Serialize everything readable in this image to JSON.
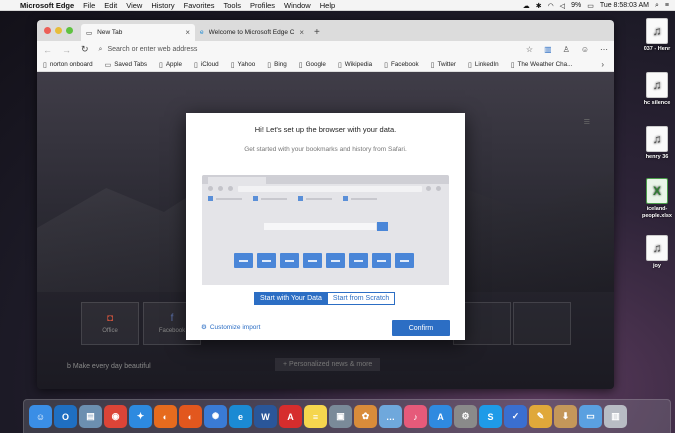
{
  "menubar": {
    "app_name": "Microsoft Edge",
    "items": [
      "File",
      "Edit",
      "View",
      "History",
      "Favorites",
      "Tools",
      "Profiles",
      "Window",
      "Help"
    ],
    "battery": "9%",
    "datetime": "Tue 8:58:03 AM"
  },
  "desktop": {
    "items": [
      {
        "label": "037 - Henr",
        "icon": "audio-file-icon"
      },
      {
        "label": "hc silence",
        "icon": "audio-file-icon"
      },
      {
        "label": "henry 36",
        "icon": "audio-file-icon"
      },
      {
        "label": "iceland-people.xlsx",
        "icon": "excel-file-icon"
      },
      {
        "label": "joy",
        "icon": "audio-file-icon"
      }
    ]
  },
  "browser": {
    "tabs": [
      {
        "title": "New Tab",
        "active": true
      },
      {
        "title": "Welcome to Microsoft Edge Ca",
        "active": false
      }
    ],
    "address_placeholder": "Search or enter web address",
    "favorites": [
      "norton onboard",
      "Saved Tabs",
      "Apple",
      "iCloud",
      "Yahoo",
      "Bing",
      "Google",
      "Wikipedia",
      "Facebook",
      "Twitter",
      "LinkedIn",
      "The Weather Cha..."
    ]
  },
  "newtab": {
    "tiles": [
      "Office",
      "Facebook"
    ],
    "footer_text": "Make every day beautiful",
    "news_button": "Personalized news & more"
  },
  "dialog": {
    "title": "Hi! Let's set up the browser with your data.",
    "subtitle": "Get started with your bookmarks and history from Safari.",
    "option_data": "Start with Your Data",
    "option_scratch": "Start from Scratch",
    "customize_label": "Customize import",
    "confirm_label": "Confirm"
  },
  "colors": {
    "accent": "#2c6ec4",
    "illustration_blue": "#4a86d8"
  },
  "dock": [
    {
      "name": "finder-icon",
      "color": "#3a8ee6",
      "glyph": "☺"
    },
    {
      "name": "outlook-icon",
      "color": "#1f6fc2",
      "glyph": "O"
    },
    {
      "name": "preview-icon",
      "color": "#6c8fb0",
      "glyph": "▤"
    },
    {
      "name": "chrome-icon",
      "color": "#db4437",
      "glyph": "◉"
    },
    {
      "name": "safari-icon",
      "color": "#2d8ae0",
      "glyph": "✦"
    },
    {
      "name": "firefox-icon",
      "color": "#e66b1e",
      "glyph": "◐"
    },
    {
      "name": "firefox-dev-icon",
      "color": "#e2571e",
      "glyph": "◐"
    },
    {
      "name": "settings-gear-icon",
      "color": "#3a7bd5",
      "glyph": "✺"
    },
    {
      "name": "edge-icon",
      "color": "#1b8ad3",
      "glyph": "e"
    },
    {
      "name": "word-icon",
      "color": "#2a5699",
      "glyph": "W"
    },
    {
      "name": "acrobat-icon",
      "color": "#d62d2d",
      "glyph": "A"
    },
    {
      "name": "notes-icon",
      "color": "#f5d64e",
      "glyph": "≡"
    },
    {
      "name": "image-viewer-icon",
      "color": "#7a8a99",
      "glyph": "▣"
    },
    {
      "name": "photos-icon",
      "color": "#d98c3a",
      "glyph": "✿"
    },
    {
      "name": "messages-icon",
      "color": "#6fa8dc",
      "glyph": "…"
    },
    {
      "name": "music-icon",
      "color": "#e65a7a",
      "glyph": "♪"
    },
    {
      "name": "app-store-icon",
      "color": "#2f8ae0",
      "glyph": "A"
    },
    {
      "name": "system-preferences-icon",
      "color": "#8a8a8a",
      "glyph": "⚙"
    },
    {
      "name": "skype-icon",
      "color": "#1e9be8",
      "glyph": "S"
    },
    {
      "name": "todo-icon",
      "color": "#3a6fd0",
      "glyph": "✓"
    },
    {
      "name": "script-editor-icon",
      "color": "#e0a83a",
      "glyph": "✎"
    },
    {
      "name": "installer-icon",
      "color": "#c4975a",
      "glyph": "⬇"
    },
    {
      "name": "folder-icon",
      "color": "#5aa0e0",
      "glyph": "▭"
    },
    {
      "name": "trash-icon",
      "color": "#b8bcc4",
      "glyph": "▥"
    }
  ]
}
